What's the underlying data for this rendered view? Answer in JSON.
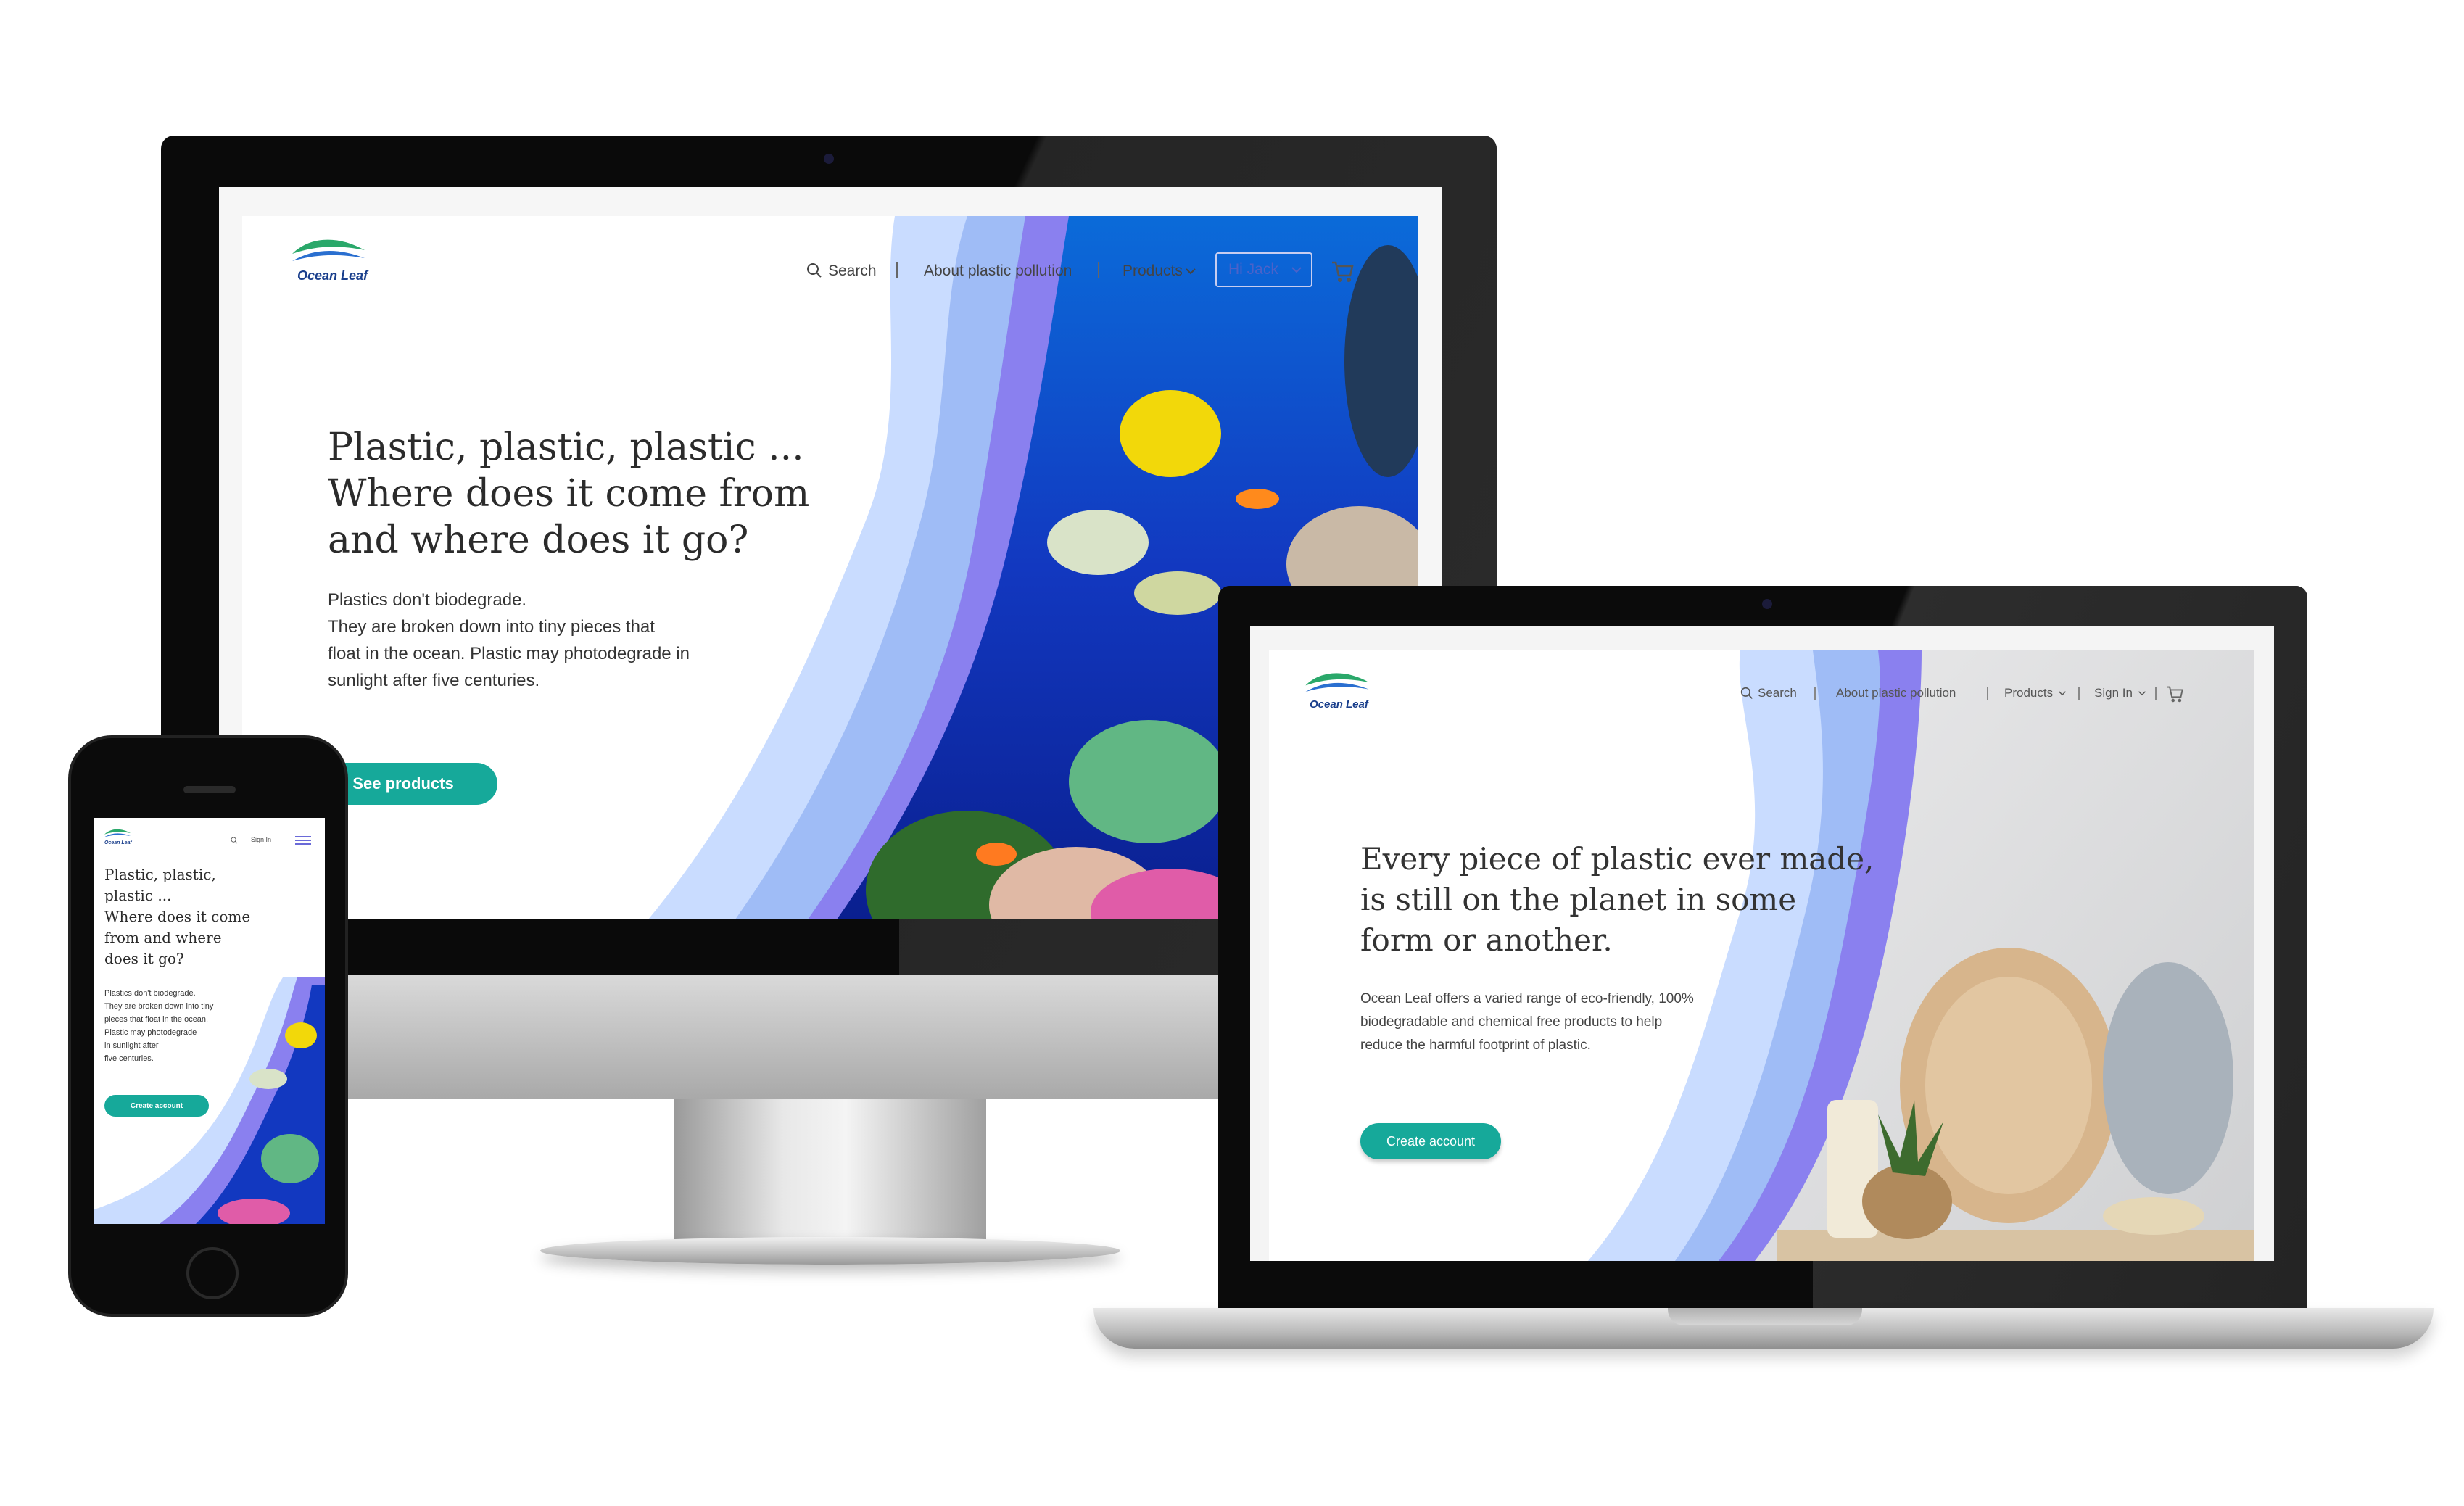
{
  "brand": {
    "name": "Ocean Leaf"
  },
  "desktop": {
    "nav": {
      "search": "Search",
      "about": "About plastic pollution",
      "products": "Products",
      "user": "Hi Jack"
    },
    "hero": {
      "heading_line1": "Plastic, plastic, plastic ...",
      "heading_line2": "Where does it come from",
      "heading_line3": "and where does it go?",
      "body_line1": "Plastics don't biodegrade.",
      "body_line2": "They are broken down into tiny pieces that",
      "body_line3": "float in the ocean. Plastic may photodegrade in",
      "body_line4": "sunlight after five centuries.",
      "cta": "See products"
    }
  },
  "laptop": {
    "nav": {
      "search": "Search",
      "about": "About plastic pollution",
      "products": "Products",
      "signin": "Sign In"
    },
    "hero": {
      "heading_line1": "Every piece of plastic ever made,",
      "heading_line2": "is still on the planet in some",
      "heading_line3": "form or another.",
      "body_line1": "Ocean Leaf offers a varied range of eco-friendly, 100%",
      "body_line2": "biodegradable and chemical free products to help",
      "body_line3": "reduce the harmful footprint of plastic.",
      "cta": "Create account"
    }
  },
  "mobile": {
    "nav": {
      "signin": "Sign In"
    },
    "hero": {
      "heading_line1": "Plastic, plastic,",
      "heading_line2": "plastic ...",
      "heading_line3": "Where does it come",
      "heading_line4": "from and where",
      "heading_line5": "does it go?",
      "body_line1": "Plastics don't biodegrade.",
      "body_line2": "They are broken down into tiny",
      "body_line3": "pieces that float in the ocean.",
      "body_line4": "Plastic may photodegrade",
      "body_line5": "in sunlight after",
      "body_line6": "five centuries.",
      "cta": "Create account"
    }
  },
  "colors": {
    "accent_teal": "#16a99a",
    "nav_blue": "#4c62c9",
    "wave_light": "#bcd6ff",
    "wave_mid": "#8fb2f7",
    "wave_purple": "#8f86f0",
    "ocean_deep": "#1236b8"
  }
}
